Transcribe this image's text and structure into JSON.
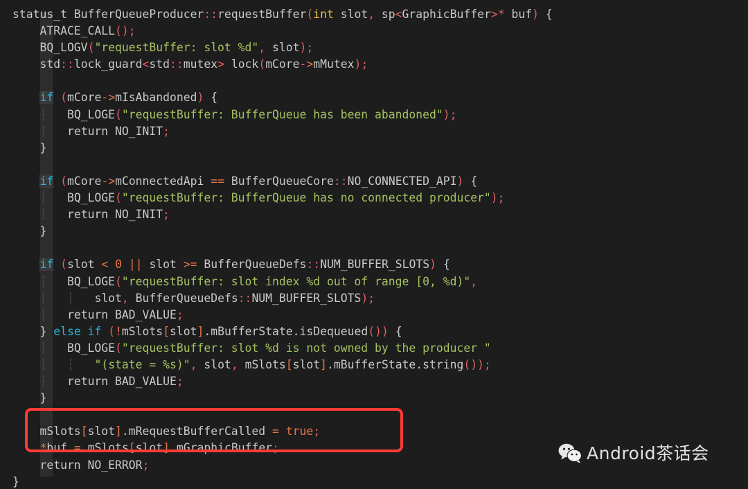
{
  "editor": {
    "background_color": "#1d1d1d",
    "indent_column_color": "#2d2d2d",
    "default_text_color": "#c9c9c9",
    "colors": {
      "keyword": "#29b6d8",
      "type": "#e8c33c",
      "string": "#a5c261",
      "punctuation": "#e05f63",
      "operator": "#e8764a",
      "number": "#e8764a",
      "indent_guide": "#4a4a4a",
      "highlight_box": "#ff3b35"
    },
    "language": "C++",
    "lines": [
      "status_t BufferQueueProducer::requestBuffer(int slot, sp<GraphicBuffer>* buf) {",
      "    ATRACE_CALL();",
      "    BQ_LOGV(\"requestBuffer: slot %d\", slot);",
      "    std::lock_guard<std::mutex> lock(mCore->mMutex);",
      "",
      "    if (mCore->mIsAbandoned) {",
      "        BQ_LOGE(\"requestBuffer: BufferQueue has been abandoned\");",
      "        return NO_INIT;",
      "    }",
      "",
      "    if (mCore->mConnectedApi == BufferQueueCore::NO_CONNECTED_API) {",
      "        BQ_LOGE(\"requestBuffer: BufferQueue has no connected producer\");",
      "        return NO_INIT;",
      "    }",
      "",
      "    if (slot < 0 || slot >= BufferQueueDefs::NUM_BUFFER_SLOTS) {",
      "        BQ_LOGE(\"requestBuffer: slot index %d out of range [0, %d)\",",
      "                slot, BufferQueueDefs::NUM_BUFFER_SLOTS);",
      "        return BAD_VALUE;",
      "    } else if (!mSlots[slot].mBufferState.isDequeued()) {",
      "        BQ_LOGE(\"requestBuffer: slot %d is not owned by the producer \"",
      "                \"(state = %s)\", slot, mSlots[slot].mBufferState.string());",
      "        return BAD_VALUE;",
      "    }",
      "",
      "    mSlots[slot].mRequestBufferCalled = true;",
      "    *buf = mSlots[slot].mGraphicBuffer;",
      "    return NO_ERROR;",
      "}"
    ]
  },
  "annotation": {
    "type": "rectangle-highlight",
    "color": "#ff3b35",
    "highlighted_lines": [
      "mSlots[slot].mRequestBufferCalled = true;",
      "*buf = mSlots[slot].mGraphicBuffer;"
    ]
  },
  "watermark": {
    "icon": "wechat-icon",
    "text": "Android茶话会",
    "color": "#e2e2e2"
  }
}
